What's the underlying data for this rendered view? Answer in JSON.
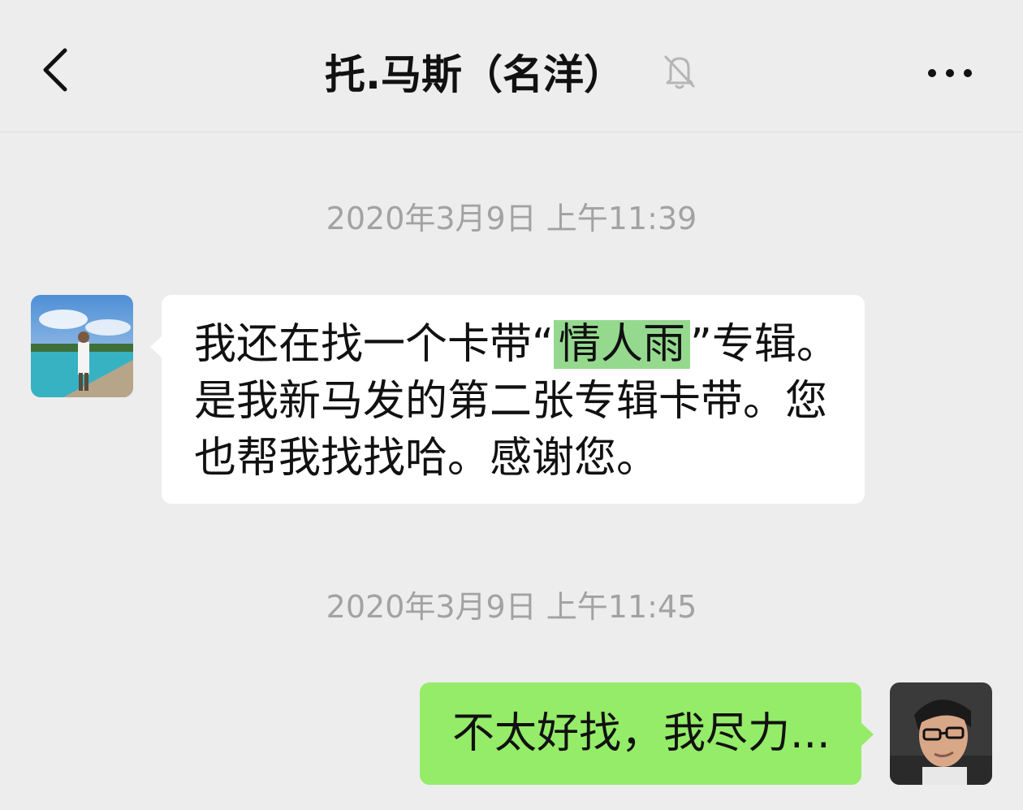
{
  "header": {
    "title": "托.马斯（名洋）",
    "back_icon": "chevron-left-icon",
    "mute_icon": "bell-off-icon",
    "more_icon": "more-dots-icon"
  },
  "messages": [
    {
      "timestamp": "2020年3月9日 上午11:39",
      "direction": "incoming",
      "lines": [
        {
          "pre": "我还在找一个卡带“",
          "highlight": "情人雨",
          "post": "”专辑。"
        },
        {
          "text": "是我新马发的第二张专辑卡带。您"
        },
        {
          "text": "也帮我找找哈。感谢您。"
        }
      ]
    },
    {
      "timestamp": "2020年3月9日 上午11:45",
      "direction": "outgoing",
      "text": "不太好找，我尽力..."
    }
  ],
  "colors": {
    "background": "#ededed",
    "incoming_bubble": "#ffffff",
    "outgoing_bubble": "#95ec69",
    "highlight": "#95d98f",
    "timestamp": "#a2a2a2"
  }
}
